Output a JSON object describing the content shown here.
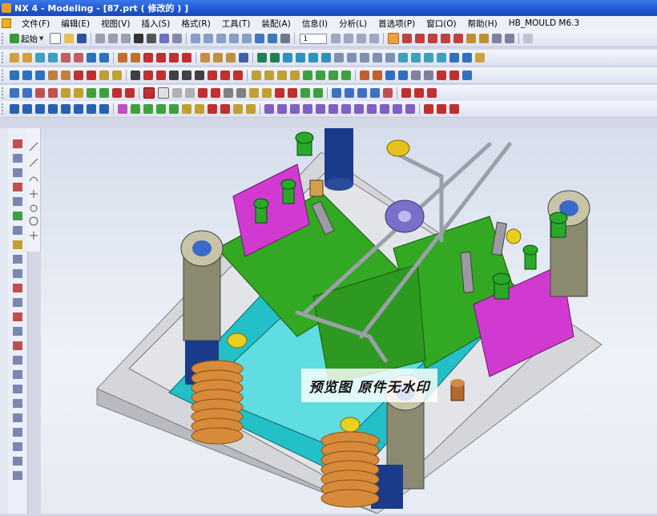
{
  "window": {
    "title": "NX 4 - Modeling - [87.prt ( 修改的 ) ]"
  },
  "menu": {
    "items": [
      "文件(F)",
      "编辑(E)",
      "视图(V)",
      "插入(S)",
      "格式(R)",
      "工具(T)",
      "装配(A)",
      "信息(I)",
      "分析(L)",
      "首选项(P)",
      "窗口(O)",
      "帮助(H)",
      "HB_MOULD M6.3"
    ]
  },
  "toolbar": {
    "start_label": "起始",
    "layer_value": "1"
  },
  "viewport": {
    "watermark": "预览图 原件无水印"
  },
  "colors": {
    "titlebar": "#1f56d0",
    "plate": "#dcdcdc",
    "cavity": "#00b0b8",
    "core": "#33aa22",
    "slider": "#cc33cc",
    "pin": "#1a3a8a",
    "spring": "#d68a3a",
    "bolt": "#2aa82a"
  }
}
